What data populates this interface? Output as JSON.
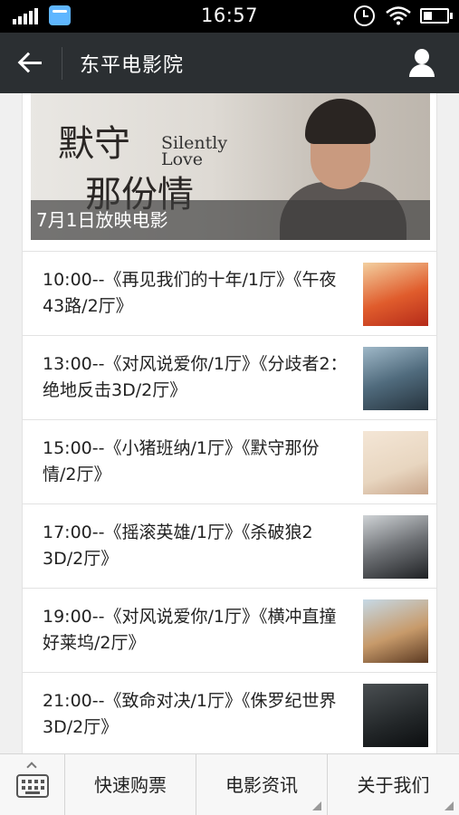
{
  "status_bar": {
    "time": "16:57",
    "icons": [
      "signal-icon",
      "message-icon",
      "alarm-icon",
      "wifi-icon",
      "battery-icon"
    ]
  },
  "header": {
    "title": "东平电影院",
    "back_icon": "back-arrow-icon",
    "profile_icon": "user-icon"
  },
  "banner": {
    "title_cn_line1": "默守",
    "title_cn_line2": "那份情",
    "title_en_line1": "Silently",
    "title_en_line2": "Love",
    "caption": "7月1日放映电影"
  },
  "showtimes": [
    {
      "text": "10:00--《再见我们的十年/1厅》《午夜43路/2厅》"
    },
    {
      "text": "13:00--《对风说爱你/1厅》《分歧者2：绝地反击3D/2厅》"
    },
    {
      "text": "15:00--《小猪班纳/1厅》《默守那份情/2厅》"
    },
    {
      "text": "17:00--《摇滚英雄/1厅》《杀破狼2 3D/2厅》"
    },
    {
      "text": "19:00--《对风说爱你/1厅》《横冲直撞好莱坞/2厅》"
    },
    {
      "text": "21:00--《致命对决/1厅》《侏罗纪世界3D/2厅》"
    }
  ],
  "bottom_menu": {
    "keyboard_icon": "keyboard-icon",
    "tabs": [
      {
        "label": "快速购票"
      },
      {
        "label": "电影资讯"
      },
      {
        "label": "关于我们"
      }
    ]
  },
  "colors": {
    "status_bar_bg": "#000000",
    "header_bg": "#2b2f32",
    "page_bg": "#f0f0f0",
    "content_bg": "#ffffff",
    "bottom_bar_bg": "#f7f7f7"
  }
}
